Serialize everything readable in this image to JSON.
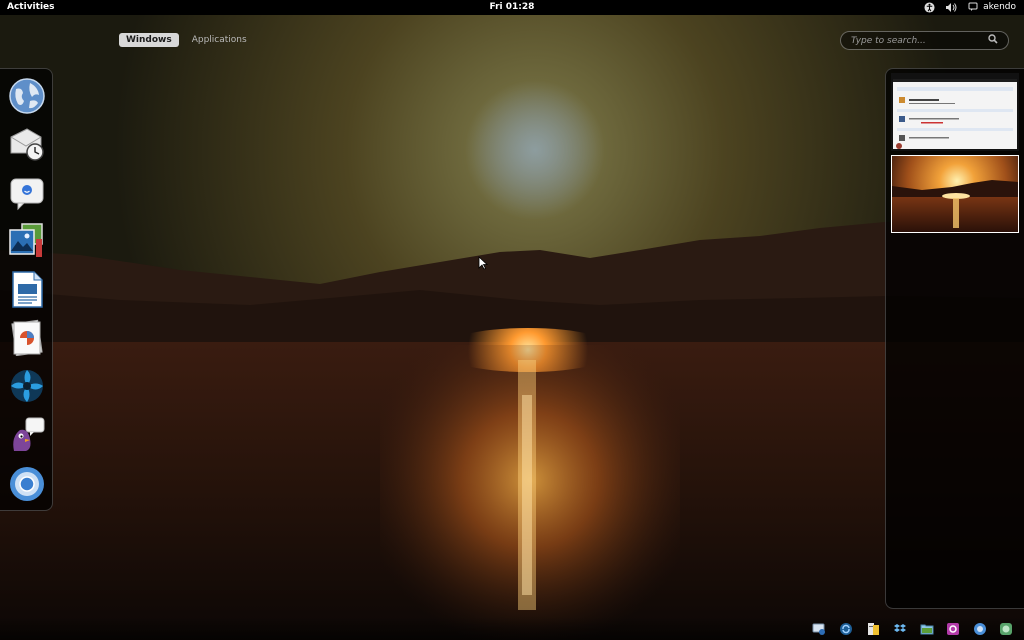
{
  "top_panel": {
    "activities_label": "Activities",
    "clock": "Fri 01:28",
    "accessibility_icon": "accessibility-icon",
    "volume_icon": "volume-icon",
    "user_icon": "user-chat-icon",
    "user_name": "akendo"
  },
  "overview": {
    "tabs": [
      {
        "label": "Windows",
        "active": true
      },
      {
        "label": "Applications",
        "active": false
      }
    ],
    "search": {
      "placeholder": "Type to search...",
      "icon": "search-icon"
    }
  },
  "dash": {
    "items": [
      {
        "name": "web-browser-icon"
      },
      {
        "name": "mail-calendar-icon"
      },
      {
        "name": "empathy-chat-icon"
      },
      {
        "name": "image-viewer-icon"
      },
      {
        "name": "writer-document-icon"
      },
      {
        "name": "presentation-icon"
      },
      {
        "name": "shutter-icon"
      },
      {
        "name": "pidgin-icon"
      },
      {
        "name": "chromium-icon"
      }
    ]
  },
  "workspaces": [
    {
      "name": "workspace-1",
      "active": false
    },
    {
      "name": "workspace-2",
      "active": true
    }
  ],
  "tray": {
    "items": [
      "network-icon",
      "sync-icon",
      "notes-icon",
      "dropbox-icon",
      "folder-icon",
      "settings-icon",
      "chat-icon",
      "update-icon"
    ]
  },
  "colors": {
    "panel_bg": "#000000",
    "active_tab_bg": "#d8d8d8",
    "wallpaper_sky": "#5a4a22",
    "wallpaper_sun": "#ffb347"
  }
}
